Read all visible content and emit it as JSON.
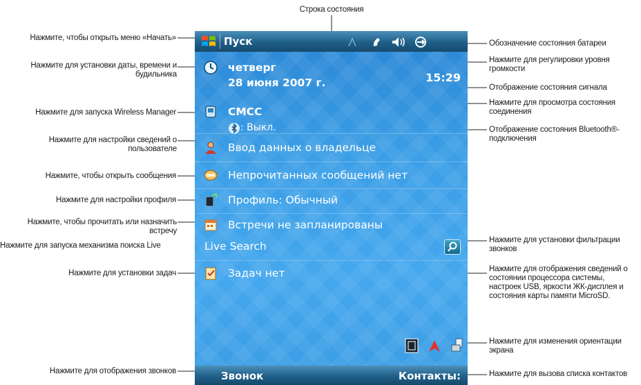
{
  "titlebar": {
    "start_label": "Пуск"
  },
  "today": {
    "day": "четверг",
    "date": "28 июня 2007 г.",
    "time": "15:29",
    "operator": "CMCC",
    "bluetooth": ": Выкл.",
    "owner": "Ввод данных о владельце",
    "messages": "Непрочитанных сообщений нет",
    "profile": "Профиль: Обычный",
    "appointments": "Встречи не запланированы",
    "search": "Live Search",
    "tasks": "Задач нет"
  },
  "softkeys": {
    "left": "Звонок",
    "right": "Контакты:"
  },
  "annotations": {
    "top": "Строка состояния",
    "left": [
      "Нажмите, чтобы открыть меню «Начать»",
      "Нажмите для установки даты, времени и будильника",
      "Нажмите для запуска Wireless Manager",
      "Нажмите для настройки сведений о пользователе",
      "Нажмите, чтобы открыть сообщения",
      "Нажмите для настройки профиля",
      "Нажмите, чтобы прочитать или назначить встречу",
      "Нажмите для запуска механизма поиска Live",
      "Нажмите для установки задач",
      "Нажмите для отображения звонков"
    ],
    "right": [
      "Обозначение состояния батареи",
      "Нажмите для регулировки уровня громкости",
      "Отображение состояния сигнала",
      "Нажмите для просмотра состояния соединения",
      "Отображение состояния Bluetooth®-подключения",
      "Нажмите для установки фильтрации звонков",
      "Нажмите для отображения сведений о состоянии процессора системы, настроек USB, яркости ЖК-дисплея и состояния карты памяти MicroSD.",
      "Нажмите для изменения ориентации экрана",
      "Нажмите для вызова списка контактов"
    ]
  },
  "colors": {
    "screen_bg": "#3b9ee6",
    "bar_bg": "#1f5f88",
    "text": "#ffffff"
  }
}
